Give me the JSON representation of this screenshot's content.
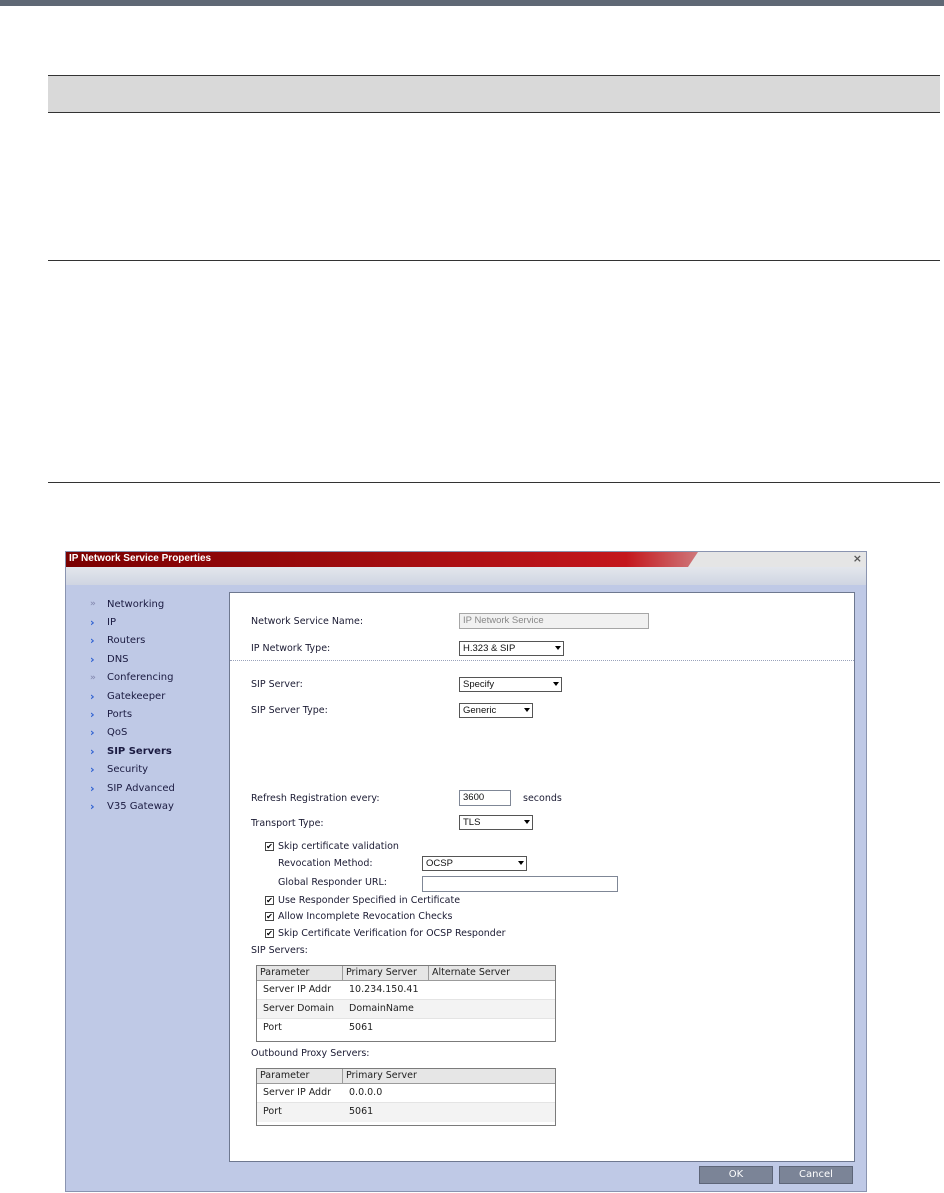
{
  "dialog": {
    "title": "IP Network Service Properties",
    "close_glyph": "×"
  },
  "nav": {
    "items": [
      {
        "label": "Networking",
        "arrow": "»"
      },
      {
        "label": "IP",
        "arrow": "›"
      },
      {
        "label": "Routers",
        "arrow": "›"
      },
      {
        "label": "DNS",
        "arrow": "›"
      },
      {
        "label": "Conferencing",
        "arrow": "»"
      },
      {
        "label": "Gatekeeper",
        "arrow": "›"
      },
      {
        "label": "Ports",
        "arrow": "›"
      },
      {
        "label": "QoS",
        "arrow": "›"
      },
      {
        "label": "SIP Servers",
        "arrow": "›",
        "active": true
      },
      {
        "label": "Security",
        "arrow": "›"
      },
      {
        "label": "SIP Advanced",
        "arrow": "›"
      },
      {
        "label": "V35 Gateway",
        "arrow": "›"
      }
    ]
  },
  "form": {
    "service_name_label": "Network Service Name:",
    "service_name_value": "IP Network Service",
    "network_type_label": "IP Network Type:",
    "network_type_value": "H.323 & SIP",
    "sip_server_label": "SIP Server:",
    "sip_server_value": "Specify",
    "sip_server_type_label": "SIP Server Type:",
    "sip_server_type_value": "Generic",
    "refresh_label": "Refresh Registration every:",
    "refresh_value": "3600",
    "refresh_unit": "seconds",
    "transport_label": "Transport Type:",
    "transport_value": "TLS",
    "skip_cert_label": "Skip certificate validation",
    "revocation_label": "Revocation Method:",
    "revocation_value": "OCSP",
    "global_url_label": "Global Responder URL:",
    "global_url_value": "",
    "use_responder_label": "Use Responder Specified in Certificate",
    "allow_incomplete_label": "Allow Incomplete Revocation Checks",
    "skip_ocsp_label": "Skip Certificate Verification for OCSP Responder",
    "check_mark": "✔"
  },
  "sip_servers": {
    "label": "SIP Servers:",
    "headers": [
      "Parameter",
      "Primary Server",
      "Alternate Server"
    ],
    "rows": [
      [
        "Server IP Addr",
        "10.234.150.41",
        ""
      ],
      [
        "Server Domain",
        "DomainName",
        ""
      ],
      [
        "Port",
        "5061",
        ""
      ]
    ]
  },
  "proxy_servers": {
    "label": "Outbound Proxy Servers:",
    "headers": [
      "Parameter",
      "Primary Server"
    ],
    "rows": [
      [
        "Server IP Addr",
        "0.0.0.0"
      ],
      [
        "Port",
        "5061"
      ]
    ]
  },
  "buttons": {
    "ok": "OK",
    "cancel": "Cancel"
  }
}
